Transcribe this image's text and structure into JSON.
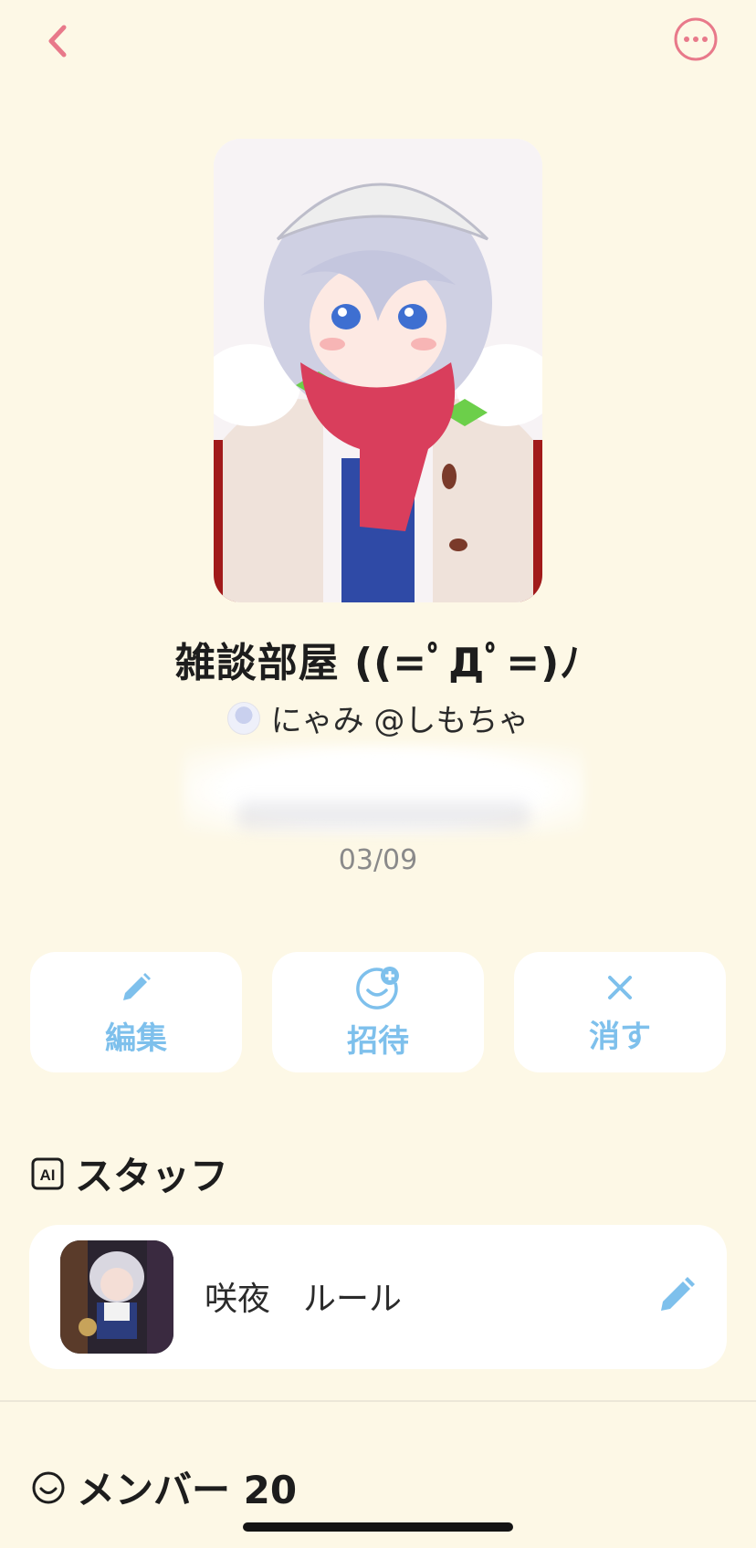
{
  "room": {
    "title": "雑談部屋 ((=ﾟДﾟ=)ﾉ",
    "owner_name": "にゃみ @しもちゃ",
    "date": "03/09"
  },
  "actions": [
    {
      "label": "編集",
      "icon": "pencil-icon"
    },
    {
      "label": "招待",
      "icon": "invite-icon"
    },
    {
      "label": "消す",
      "icon": "close-icon"
    }
  ],
  "staff_section": {
    "title": "スタッフ",
    "icon_text": "AI",
    "items": [
      {
        "name": "咲夜　ルール",
        "icon": "pencil-icon"
      }
    ]
  },
  "members_section": {
    "title": "メンバー 20"
  },
  "colors": {
    "background": "#fdf8e6",
    "accent_pink": "#e8798a",
    "accent_blue": "#7ec0ec"
  }
}
